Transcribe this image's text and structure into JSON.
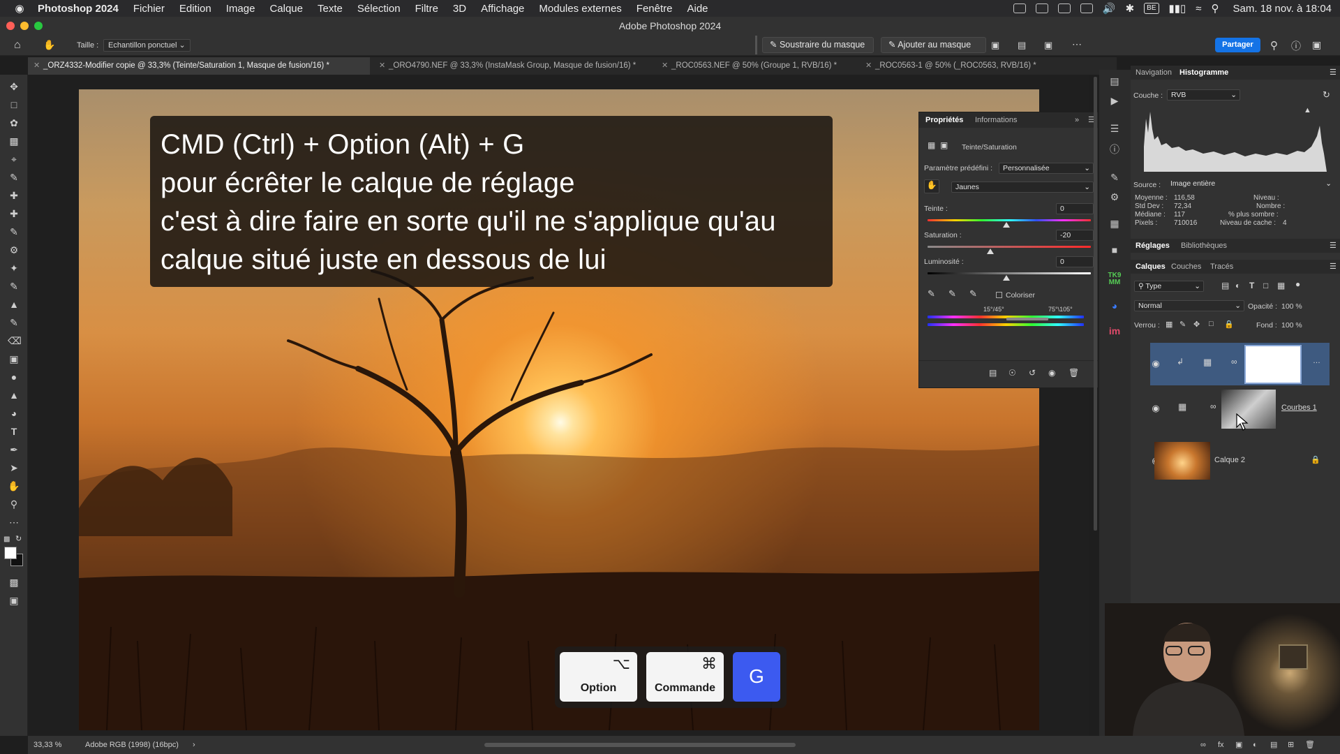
{
  "menubar": {
    "app_name": "Photoshop 2024",
    "items": [
      "Fichier",
      "Edition",
      "Image",
      "Calque",
      "Texte",
      "Sélection",
      "Filtre",
      "3D",
      "Affichage",
      "Modules externes",
      "Fenêtre",
      "Aide"
    ],
    "datetime": "Sam. 18 nov. à 18:04",
    "input_badge": "BE"
  },
  "window": {
    "title": "Adobe Photoshop 2024"
  },
  "options": {
    "size_label": "Taille :",
    "size_value": "Echantillon ponctuel",
    "subtract_mask": "Soustraire du masque",
    "add_mask": "Ajouter au masque",
    "share": "Partager"
  },
  "doc_tabs": [
    "_ORZ4332-Modifier copie @ 33,3% (Teinte/Saturation 1, Masque de fusion/16) *",
    "_ORO4790.NEF @ 33,3% (InstaMask Group, Masque de fusion/16) *",
    "_ROC0563.NEF @ 50% (Groupe 1, RVB/16) *",
    "_ROC0563-1 @ 50% (_ROC0563, RVB/16) *"
  ],
  "overlay": {
    "lines": [
      "CMD (Ctrl) + Option (Alt) + G",
      "pour écrêter le calque de réglage",
      "c'est à dire faire en sorte qu'il ne s'applique qu'au",
      "calque situé juste en dessous de lui"
    ],
    "keys": [
      {
        "symbol": "⌥",
        "label": "Option"
      },
      {
        "symbol": "⌘",
        "label": "Commande"
      },
      {
        "symbol": "",
        "label": "G"
      }
    ]
  },
  "properties": {
    "tab_active": "Propriétés",
    "tab_other": "Informations",
    "adjustment_name": "Teinte/Saturation",
    "preset_label": "Paramètre prédéfini :",
    "preset_value": "Personnalisée",
    "channel_value": "Jaunes",
    "hue_label": "Teinte :",
    "hue_value": "0",
    "saturation_label": "Saturation :",
    "saturation_value": "-20",
    "lightness_label": "Luminosité :",
    "lightness_value": "0",
    "colorize_label": "Coloriser",
    "range_left": "15°/45°",
    "range_right": "75°\\105°"
  },
  "histogram": {
    "tab_nav": "Navigation",
    "tab_hist": "Histogramme",
    "channel_label": "Couche :",
    "channel_value": "RVB",
    "source_label": "Source :",
    "source_value": "Image entière",
    "stats_left": [
      {
        "k": "Moyenne :",
        "v": "116,58"
      },
      {
        "k": "Std Dev :",
        "v": "72,34"
      },
      {
        "k": "Médiane :",
        "v": "117"
      },
      {
        "k": "Pixels :",
        "v": "710016"
      }
    ],
    "stats_right": [
      {
        "k": "Niveau :",
        "v": ""
      },
      {
        "k": "Nombre :",
        "v": ""
      },
      {
        "k": "% plus sombre :",
        "v": ""
      },
      {
        "k": "Niveau de cache :",
        "v": "4"
      }
    ]
  },
  "adjust_panel": {
    "tab_active": "Réglages",
    "tab_other": "Bibliothèques"
  },
  "layers_panel": {
    "tabs": [
      "Calques",
      "Couches",
      "Tracés"
    ],
    "filter_value": "Type",
    "blend_mode": "Normal",
    "opacity_label": "Opacité :",
    "opacity_value": "100 %",
    "lock_label": "Verrou :",
    "fill_label": "Fond :",
    "fill_value": "100 %",
    "layers": [
      {
        "name": "",
        "selected": true
      },
      {
        "name": "Courbes 1",
        "selected": false
      },
      {
        "name": "Calque 2",
        "selected": false
      }
    ]
  },
  "statusbar": {
    "zoom": "33,33 %",
    "profile": "Adobe RGB (1998) (16bpc)"
  },
  "colors": {
    "accent": "#1473e6",
    "panel": "#323232",
    "selected_layer": "#3e5a80",
    "g_key": "#3c5af0"
  }
}
